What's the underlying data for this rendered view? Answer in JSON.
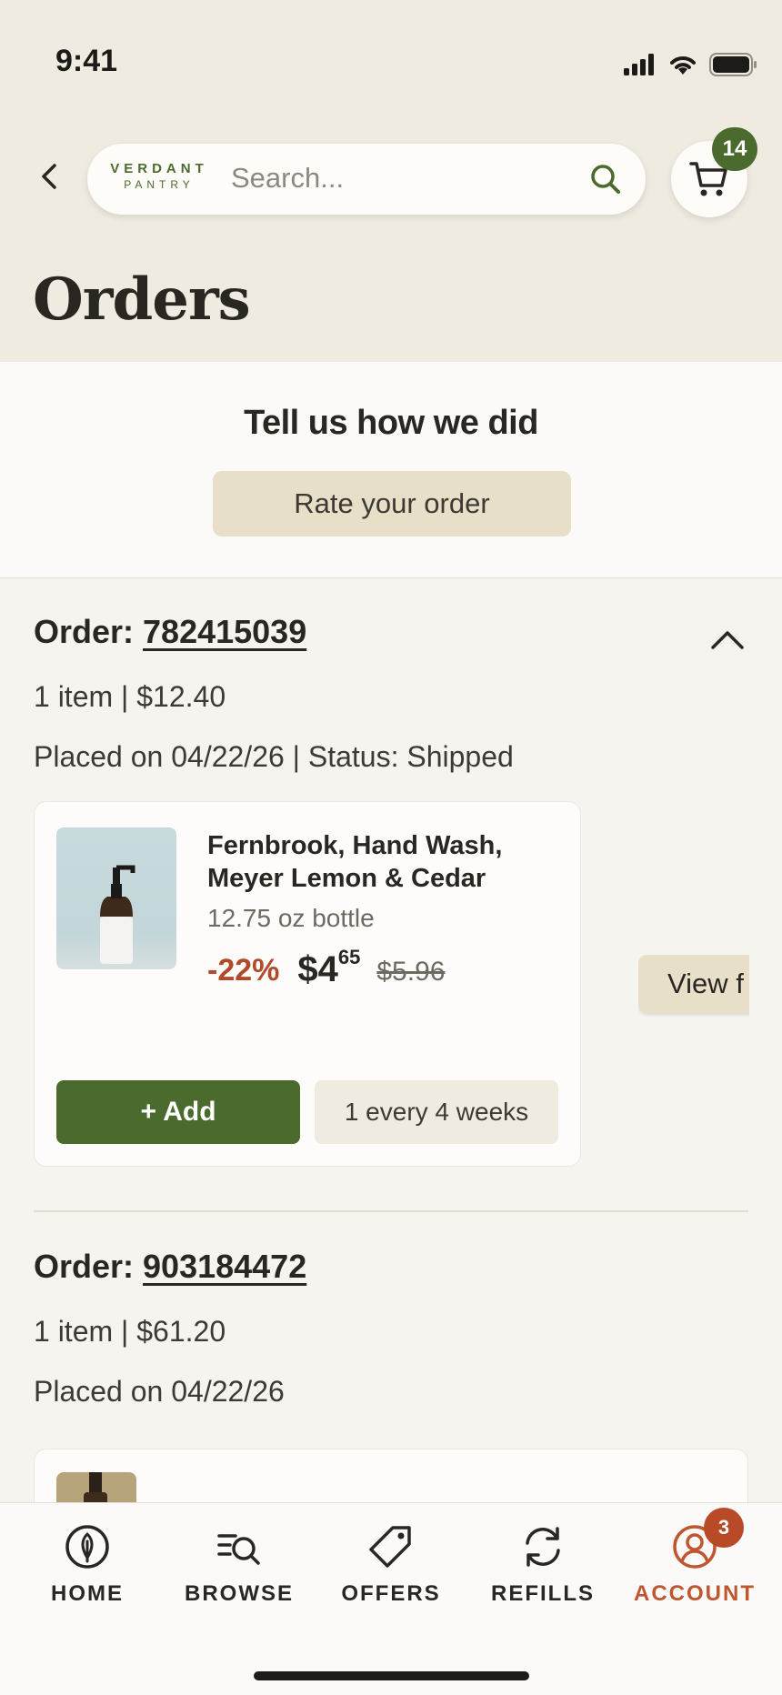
{
  "status_bar": {
    "time": "9:41"
  },
  "header": {
    "logo_line1": "VERDANT",
    "logo_line2": "PANTRY",
    "search_placeholder": "Search...",
    "cart_count": "14",
    "page_title": "Orders"
  },
  "feedback": {
    "title": "Tell us how we did",
    "button": "Rate your order"
  },
  "orders": [
    {
      "label": "Order: ",
      "number": "782415039",
      "items_total": "1 item  |  $12.40",
      "placed_status": "Placed on 04/22/26  |  Status: Shipped",
      "product": {
        "name": "Fernbrook, Hand Wash, Meyer Lemon & Cedar",
        "size": "12.75 oz bottle",
        "discount": "-22%",
        "price_dollars": "$4",
        "price_cents": "65",
        "price_old": "$5.96",
        "add_label": "+ Add",
        "frequency": "1 every 4 weeks"
      },
      "view_button": "View f"
    },
    {
      "label": "Order: ",
      "number": "903184472",
      "items_total": "1 item  |  $61.20",
      "placed": "Placed on 04/22/26"
    }
  ],
  "tabbar": {
    "tabs": [
      {
        "label": "HOME",
        "icon": "leaf-icon"
      },
      {
        "label": "BROWSE",
        "icon": "browse-search-icon"
      },
      {
        "label": "OFFERS",
        "icon": "tag-icon"
      },
      {
        "label": "REFILLS",
        "icon": "refresh-icon"
      },
      {
        "label": "ACCOUNT",
        "icon": "account-icon",
        "active": true
      }
    ],
    "account_badge": "3"
  },
  "colors": {
    "brand_green": "#4a6a2e",
    "accent_orange": "#c0562f",
    "discount_red": "#b04a2a",
    "header_bg": "#efebe1"
  }
}
